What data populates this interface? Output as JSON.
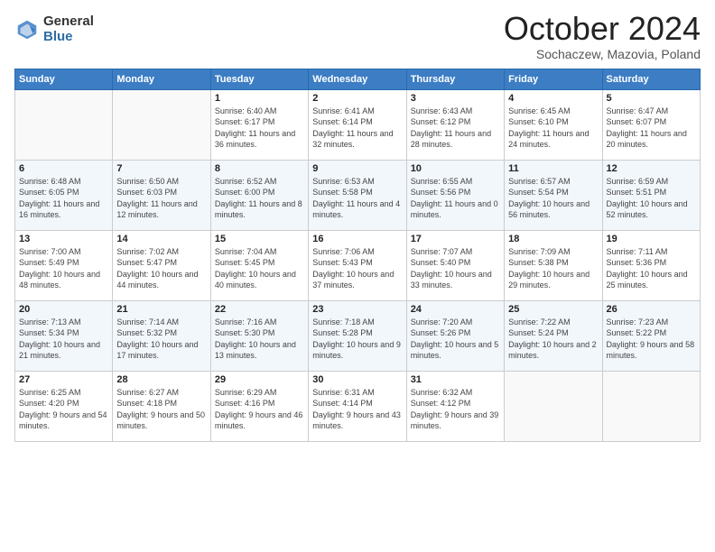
{
  "logo": {
    "general": "General",
    "blue": "Blue"
  },
  "title": "October 2024",
  "location": "Sochaczew, Mazovia, Poland",
  "days_of_week": [
    "Sunday",
    "Monday",
    "Tuesday",
    "Wednesday",
    "Thursday",
    "Friday",
    "Saturday"
  ],
  "weeks": [
    [
      {
        "day": "",
        "sunrise": "",
        "sunset": "",
        "daylight": ""
      },
      {
        "day": "",
        "sunrise": "",
        "sunset": "",
        "daylight": ""
      },
      {
        "day": "1",
        "sunrise": "Sunrise: 6:40 AM",
        "sunset": "Sunset: 6:17 PM",
        "daylight": "Daylight: 11 hours and 36 minutes."
      },
      {
        "day": "2",
        "sunrise": "Sunrise: 6:41 AM",
        "sunset": "Sunset: 6:14 PM",
        "daylight": "Daylight: 11 hours and 32 minutes."
      },
      {
        "day": "3",
        "sunrise": "Sunrise: 6:43 AM",
        "sunset": "Sunset: 6:12 PM",
        "daylight": "Daylight: 11 hours and 28 minutes."
      },
      {
        "day": "4",
        "sunrise": "Sunrise: 6:45 AM",
        "sunset": "Sunset: 6:10 PM",
        "daylight": "Daylight: 11 hours and 24 minutes."
      },
      {
        "day": "5",
        "sunrise": "Sunrise: 6:47 AM",
        "sunset": "Sunset: 6:07 PM",
        "daylight": "Daylight: 11 hours and 20 minutes."
      }
    ],
    [
      {
        "day": "6",
        "sunrise": "Sunrise: 6:48 AM",
        "sunset": "Sunset: 6:05 PM",
        "daylight": "Daylight: 11 hours and 16 minutes."
      },
      {
        "day": "7",
        "sunrise": "Sunrise: 6:50 AM",
        "sunset": "Sunset: 6:03 PM",
        "daylight": "Daylight: 11 hours and 12 minutes."
      },
      {
        "day": "8",
        "sunrise": "Sunrise: 6:52 AM",
        "sunset": "Sunset: 6:00 PM",
        "daylight": "Daylight: 11 hours and 8 minutes."
      },
      {
        "day": "9",
        "sunrise": "Sunrise: 6:53 AM",
        "sunset": "Sunset: 5:58 PM",
        "daylight": "Daylight: 11 hours and 4 minutes."
      },
      {
        "day": "10",
        "sunrise": "Sunrise: 6:55 AM",
        "sunset": "Sunset: 5:56 PM",
        "daylight": "Daylight: 11 hours and 0 minutes."
      },
      {
        "day": "11",
        "sunrise": "Sunrise: 6:57 AM",
        "sunset": "Sunset: 5:54 PM",
        "daylight": "Daylight: 10 hours and 56 minutes."
      },
      {
        "day": "12",
        "sunrise": "Sunrise: 6:59 AM",
        "sunset": "Sunset: 5:51 PM",
        "daylight": "Daylight: 10 hours and 52 minutes."
      }
    ],
    [
      {
        "day": "13",
        "sunrise": "Sunrise: 7:00 AM",
        "sunset": "Sunset: 5:49 PM",
        "daylight": "Daylight: 10 hours and 48 minutes."
      },
      {
        "day": "14",
        "sunrise": "Sunrise: 7:02 AM",
        "sunset": "Sunset: 5:47 PM",
        "daylight": "Daylight: 10 hours and 44 minutes."
      },
      {
        "day": "15",
        "sunrise": "Sunrise: 7:04 AM",
        "sunset": "Sunset: 5:45 PM",
        "daylight": "Daylight: 10 hours and 40 minutes."
      },
      {
        "day": "16",
        "sunrise": "Sunrise: 7:06 AM",
        "sunset": "Sunset: 5:43 PM",
        "daylight": "Daylight: 10 hours and 37 minutes."
      },
      {
        "day": "17",
        "sunrise": "Sunrise: 7:07 AM",
        "sunset": "Sunset: 5:40 PM",
        "daylight": "Daylight: 10 hours and 33 minutes."
      },
      {
        "day": "18",
        "sunrise": "Sunrise: 7:09 AM",
        "sunset": "Sunset: 5:38 PM",
        "daylight": "Daylight: 10 hours and 29 minutes."
      },
      {
        "day": "19",
        "sunrise": "Sunrise: 7:11 AM",
        "sunset": "Sunset: 5:36 PM",
        "daylight": "Daylight: 10 hours and 25 minutes."
      }
    ],
    [
      {
        "day": "20",
        "sunrise": "Sunrise: 7:13 AM",
        "sunset": "Sunset: 5:34 PM",
        "daylight": "Daylight: 10 hours and 21 minutes."
      },
      {
        "day": "21",
        "sunrise": "Sunrise: 7:14 AM",
        "sunset": "Sunset: 5:32 PM",
        "daylight": "Daylight: 10 hours and 17 minutes."
      },
      {
        "day": "22",
        "sunrise": "Sunrise: 7:16 AM",
        "sunset": "Sunset: 5:30 PM",
        "daylight": "Daylight: 10 hours and 13 minutes."
      },
      {
        "day": "23",
        "sunrise": "Sunrise: 7:18 AM",
        "sunset": "Sunset: 5:28 PM",
        "daylight": "Daylight: 10 hours and 9 minutes."
      },
      {
        "day": "24",
        "sunrise": "Sunrise: 7:20 AM",
        "sunset": "Sunset: 5:26 PM",
        "daylight": "Daylight: 10 hours and 5 minutes."
      },
      {
        "day": "25",
        "sunrise": "Sunrise: 7:22 AM",
        "sunset": "Sunset: 5:24 PM",
        "daylight": "Daylight: 10 hours and 2 minutes."
      },
      {
        "day": "26",
        "sunrise": "Sunrise: 7:23 AM",
        "sunset": "Sunset: 5:22 PM",
        "daylight": "Daylight: 9 hours and 58 minutes."
      }
    ],
    [
      {
        "day": "27",
        "sunrise": "Sunrise: 6:25 AM",
        "sunset": "Sunset: 4:20 PM",
        "daylight": "Daylight: 9 hours and 54 minutes."
      },
      {
        "day": "28",
        "sunrise": "Sunrise: 6:27 AM",
        "sunset": "Sunset: 4:18 PM",
        "daylight": "Daylight: 9 hours and 50 minutes."
      },
      {
        "day": "29",
        "sunrise": "Sunrise: 6:29 AM",
        "sunset": "Sunset: 4:16 PM",
        "daylight": "Daylight: 9 hours and 46 minutes."
      },
      {
        "day": "30",
        "sunrise": "Sunrise: 6:31 AM",
        "sunset": "Sunset: 4:14 PM",
        "daylight": "Daylight: 9 hours and 43 minutes."
      },
      {
        "day": "31",
        "sunrise": "Sunrise: 6:32 AM",
        "sunset": "Sunset: 4:12 PM",
        "daylight": "Daylight: 9 hours and 39 minutes."
      },
      {
        "day": "",
        "sunrise": "",
        "sunset": "",
        "daylight": ""
      },
      {
        "day": "",
        "sunrise": "",
        "sunset": "",
        "daylight": ""
      }
    ]
  ]
}
